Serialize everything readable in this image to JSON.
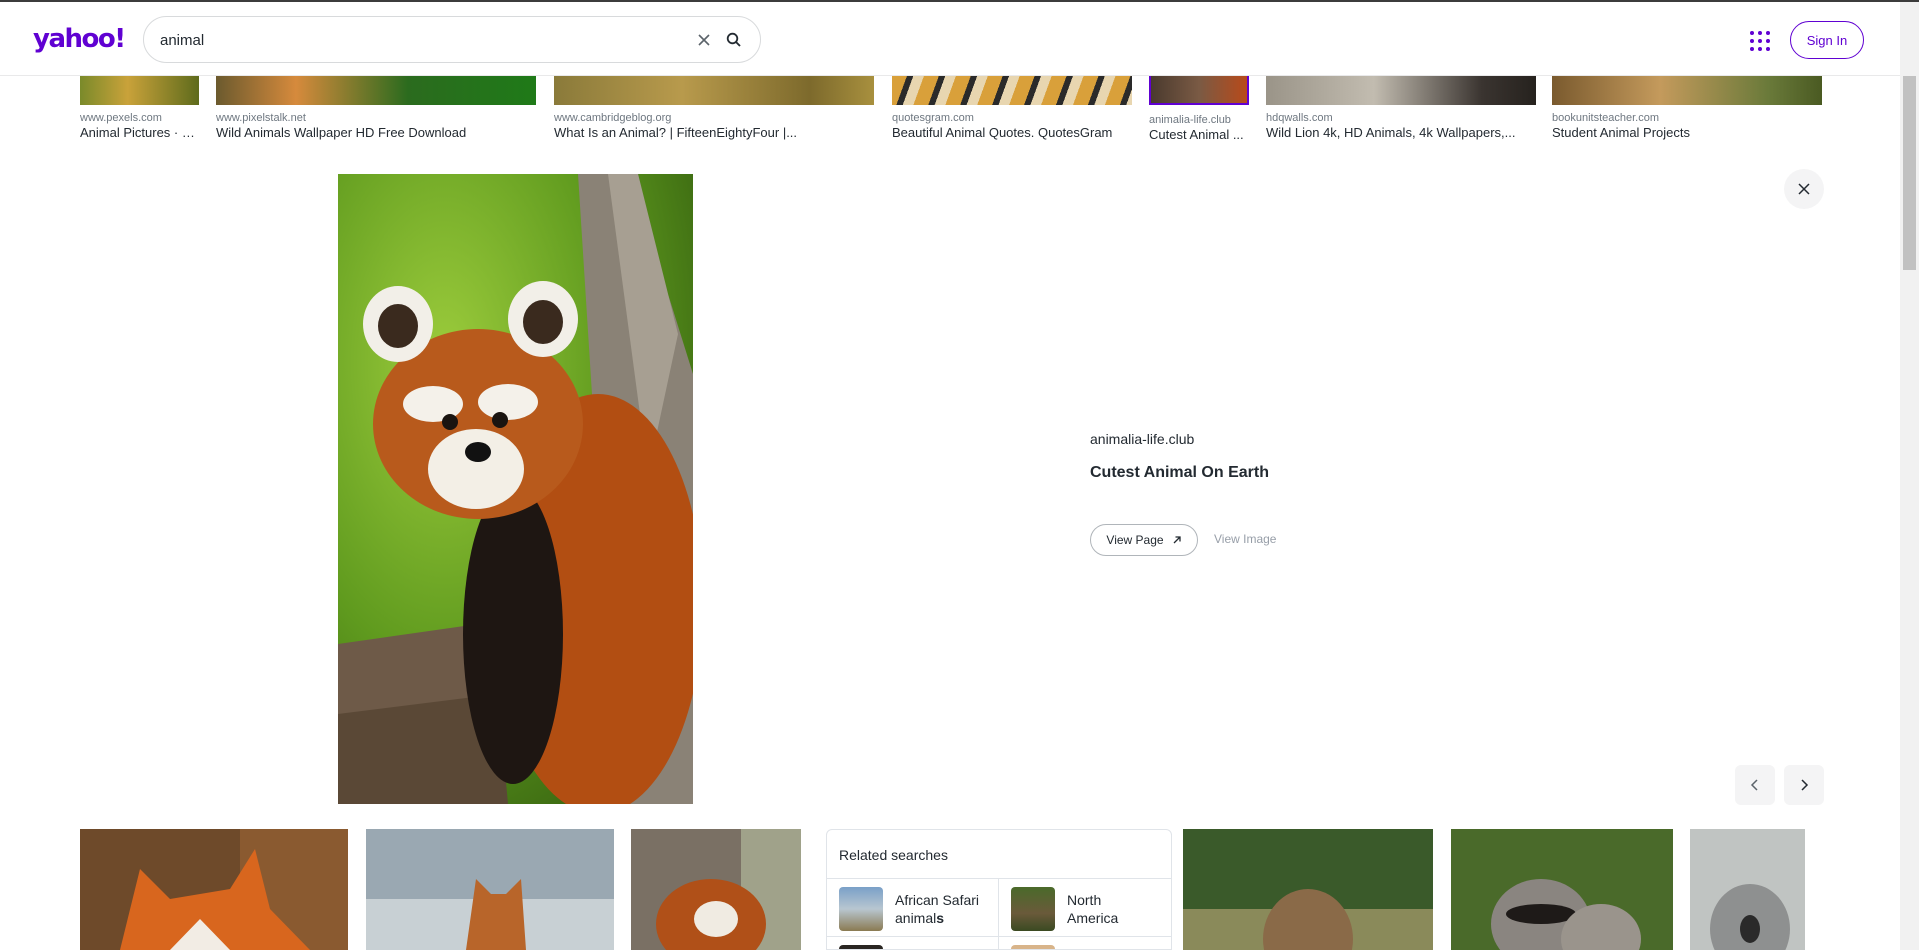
{
  "header": {
    "logo": "yahoo!",
    "search_value": "animal",
    "signin_label": "Sign In"
  },
  "top_results": [
    {
      "source": "www.pexels.com",
      "title": "Animal Pictures · P..."
    },
    {
      "source": "www.pixelstalk.net",
      "title": "Wild Animals Wallpaper HD Free Download"
    },
    {
      "source": "www.cambridgeblog.org",
      "title": "What Is an Animal? | FifteenEightyFour |..."
    },
    {
      "source": "quotesgram.com",
      "title": "Beautiful Animal Quotes. QuotesGram"
    },
    {
      "source": "animalia-life.club",
      "title": "Cutest Animal ..."
    },
    {
      "source": "hdqwalls.com",
      "title": "Wild Lion 4k, HD Animals, 4k Wallpapers,..."
    },
    {
      "source": "bookunitsteacher.com",
      "title": "Student Animal Projects"
    }
  ],
  "detail": {
    "source": "animalia-life.club",
    "title": "Cutest Animal On Earth",
    "view_page_label": "View Page",
    "view_image_label": "View Image"
  },
  "related": {
    "heading": "Related searches",
    "items": [
      {
        "line1": "African Safari",
        "line2_plain": "animal",
        "line2_bold": "s"
      },
      {
        "line1": "North",
        "line2_plain": "America",
        "line2_bold": ""
      }
    ]
  },
  "colors": {
    "brand": "#6001d2",
    "text": "#232a31",
    "muted": "#6e7780"
  },
  "icons": [
    "clear-icon",
    "search-icon",
    "apps-grid-icon",
    "close-icon",
    "chevron-left-icon",
    "chevron-right-icon",
    "external-link-icon"
  ]
}
